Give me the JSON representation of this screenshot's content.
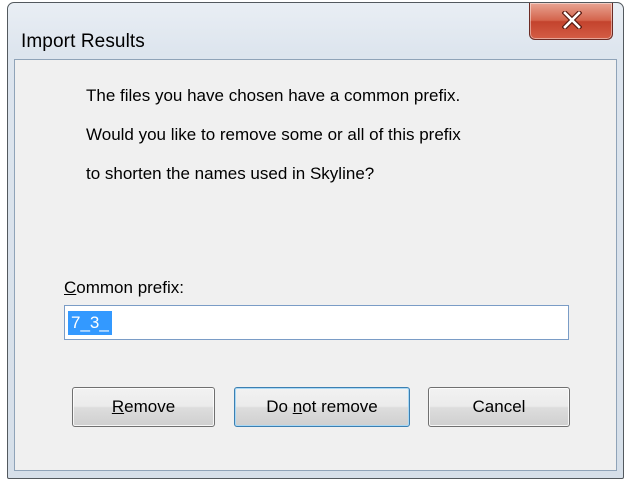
{
  "window": {
    "title": "Import Results",
    "close_icon": "close-x-icon"
  },
  "message": {
    "line1": "The files you have chosen have a common prefix.",
    "line2": "Would you like to remove some or all of this prefix",
    "line3": "to shorten the names used in Skyline?"
  },
  "prefix": {
    "label_mnemonic": "C",
    "label_rest": "ommon prefix:",
    "value": "7_3_"
  },
  "buttons": {
    "remove_mnemonic": "R",
    "remove_rest": "emove",
    "donot_pre": "Do ",
    "donot_mnemonic": "n",
    "donot_rest": "ot remove",
    "cancel": "Cancel"
  },
  "colors": {
    "close_button": "#c7432b",
    "selection": "#3399ff",
    "dialog_background": "#f0f0f0"
  }
}
